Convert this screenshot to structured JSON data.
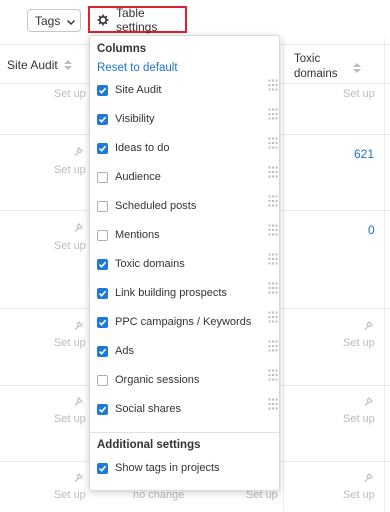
{
  "toolbar": {
    "tags_label": "Tags",
    "table_settings_label": "Table settings",
    "highlight_color": "#e0202a"
  },
  "table": {
    "col_site_audit": "Site Audit",
    "col_toxic_line1": "Toxic",
    "col_toxic_line2": "domains",
    "setup_text": "Set up",
    "no_change_text": "no change",
    "toxic_value_row2": "621",
    "toxic_value_row3": "0"
  },
  "panel": {
    "columns_title": "Columns",
    "reset_label": "Reset to default",
    "options": [
      {
        "label": "Site Audit",
        "checked": true
      },
      {
        "label": "Visibility",
        "checked": true
      },
      {
        "label": "Ideas to do",
        "checked": true
      },
      {
        "label": "Audience",
        "checked": false
      },
      {
        "label": "Scheduled posts",
        "checked": false
      },
      {
        "label": "Mentions",
        "checked": false
      },
      {
        "label": "Toxic domains",
        "checked": true
      },
      {
        "label": "Link building prospects",
        "checked": true
      },
      {
        "label": "PPC campaigns / Keywords",
        "checked": true
      },
      {
        "label": "Ads",
        "checked": true
      },
      {
        "label": "Organic sessions",
        "checked": false
      },
      {
        "label": "Social shares",
        "checked": true
      }
    ],
    "additional_title": "Additional settings",
    "show_tags_label": "Show tags in projects",
    "show_tags_checked": true
  },
  "colors": {
    "accent": "#1e7ad6",
    "link": "#1a73c9"
  }
}
